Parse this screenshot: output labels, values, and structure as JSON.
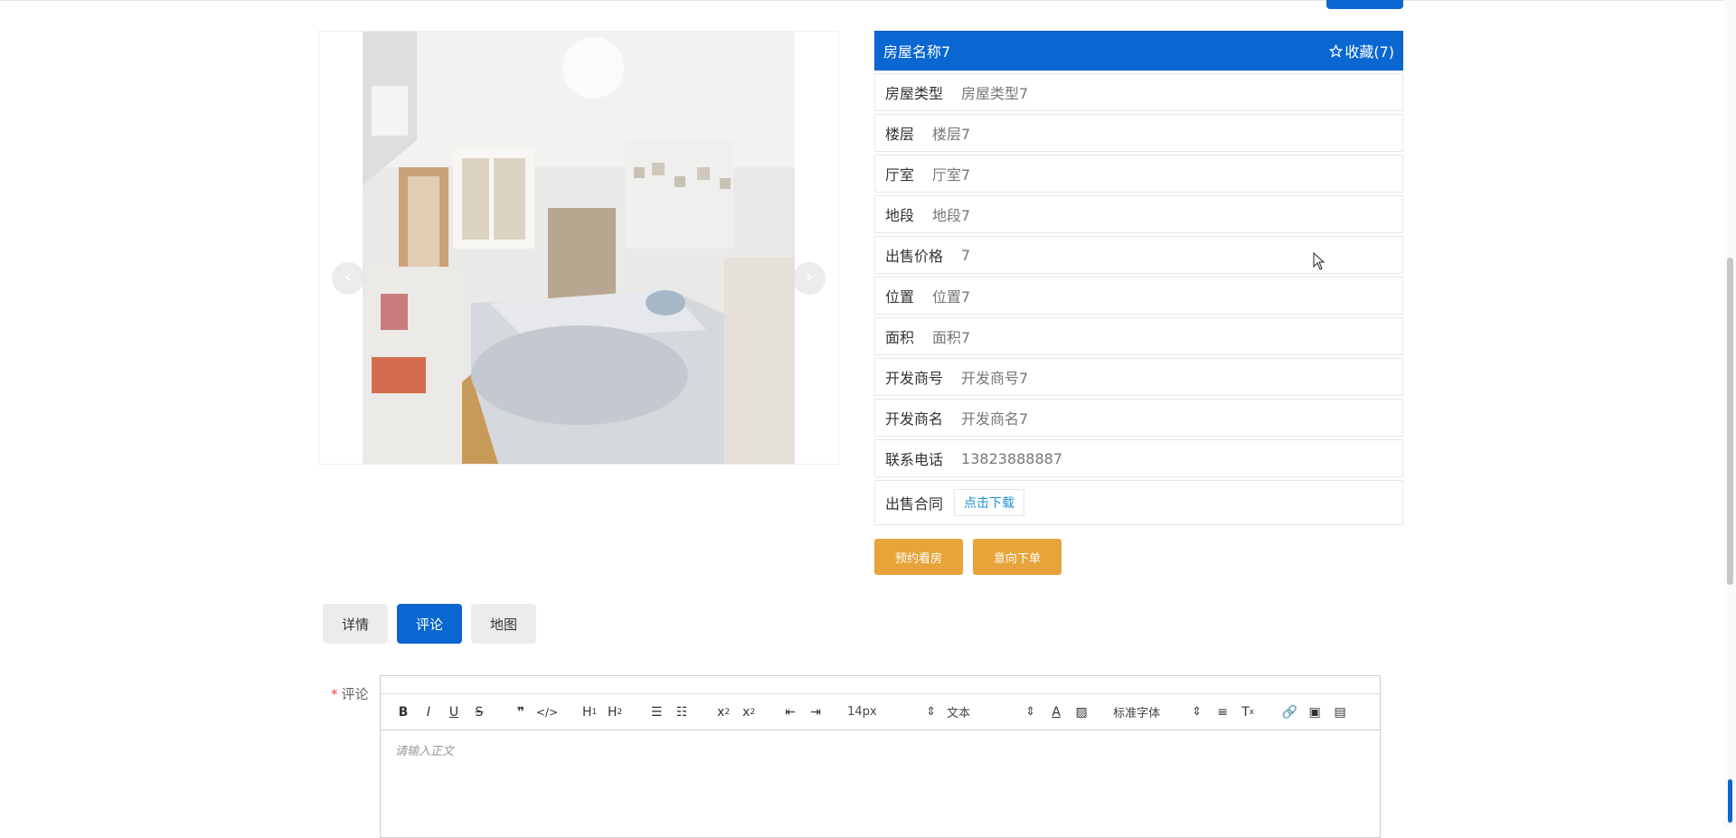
{
  "header": {},
  "gallery": {
    "prev_glyph": "‹",
    "next_glyph": "›",
    "slide_count": 3,
    "active_slide": 1
  },
  "house": {
    "name": "房屋名称7",
    "favorite_label": "收藏(7)",
    "fields": [
      {
        "label": "房屋类型",
        "value": "房屋类型7"
      },
      {
        "label": "楼层",
        "value": "楼层7"
      },
      {
        "label": "厅室",
        "value": "厅室7"
      },
      {
        "label": "地段",
        "value": "地段7"
      },
      {
        "label": "出售价格",
        "value": "7"
      },
      {
        "label": "位置",
        "value": "位置7"
      },
      {
        "label": "面积",
        "value": "面积7"
      },
      {
        "label": "开发商号",
        "value": "开发商号7"
      },
      {
        "label": "开发商名",
        "value": "开发商名7"
      },
      {
        "label": "联系电话",
        "value": "13823888887"
      }
    ],
    "contract_label": "出售合同",
    "download_label": "点击下载"
  },
  "actions": {
    "book_viewing": "预约看房",
    "intent_order": "意向下单"
  },
  "tabs": [
    {
      "label": "详情",
      "active": false
    },
    {
      "label": "评论",
      "active": true
    },
    {
      "label": "地图",
      "active": false
    }
  ],
  "comment": {
    "required_mark": "*",
    "label": "评论",
    "placeholder": "请输入正文",
    "font_size": "14px",
    "text_style": "文本",
    "font_family": "标准字体"
  },
  "colors": {
    "primary": "#0a66d1",
    "accent": "#e6a43a",
    "link": "#1e90d6"
  }
}
